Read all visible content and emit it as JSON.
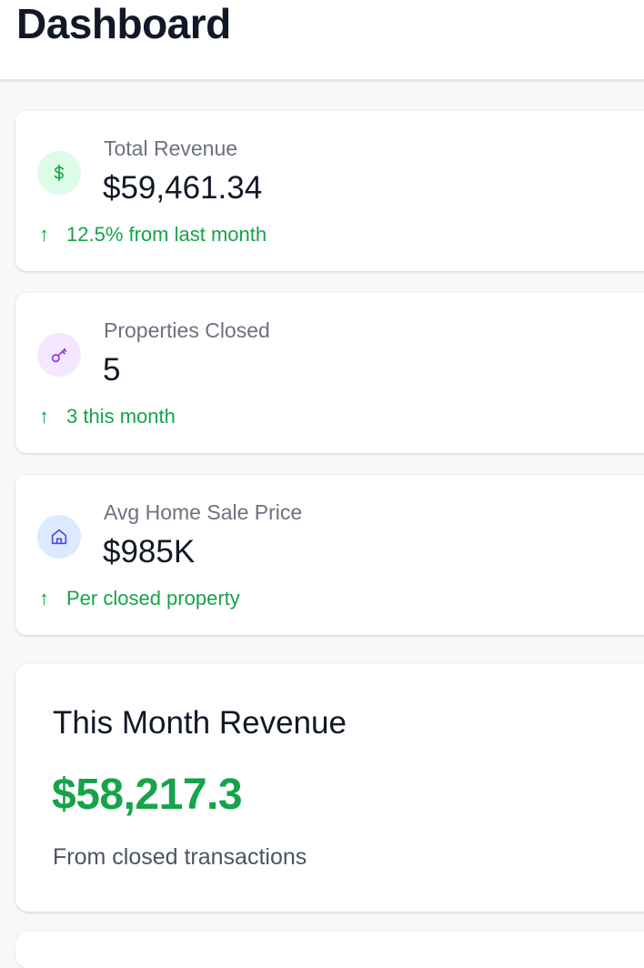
{
  "header": {
    "title": "Dashboard"
  },
  "stats": [
    {
      "label": "Total Revenue",
      "value": "$59,461.34",
      "trend_arrow": "↑",
      "trend": "12.5% from last month",
      "icon": "dollar-icon",
      "icon_color": "#16a34a",
      "icon_bg": "#dcfce7"
    },
    {
      "label": "Properties Closed",
      "value": "5",
      "trend_arrow": "↑",
      "trend": "3 this month",
      "icon": "key-icon",
      "icon_color": "#9333ea",
      "icon_bg": "#f3e8ff"
    },
    {
      "label": "Avg Home Sale Price",
      "value": "$985K",
      "trend_arrow": "↑",
      "trend": "Per closed property",
      "icon": "home-icon",
      "icon_color": "#4f46e5",
      "icon_bg": "#dbeafe"
    }
  ],
  "revenue_card": {
    "title": "This Month Revenue",
    "amount": "$58,217.3",
    "subtitle": "From closed transactions"
  },
  "colors": {
    "positive": "#16a34a",
    "muted": "#6b7280",
    "text": "#111827"
  }
}
